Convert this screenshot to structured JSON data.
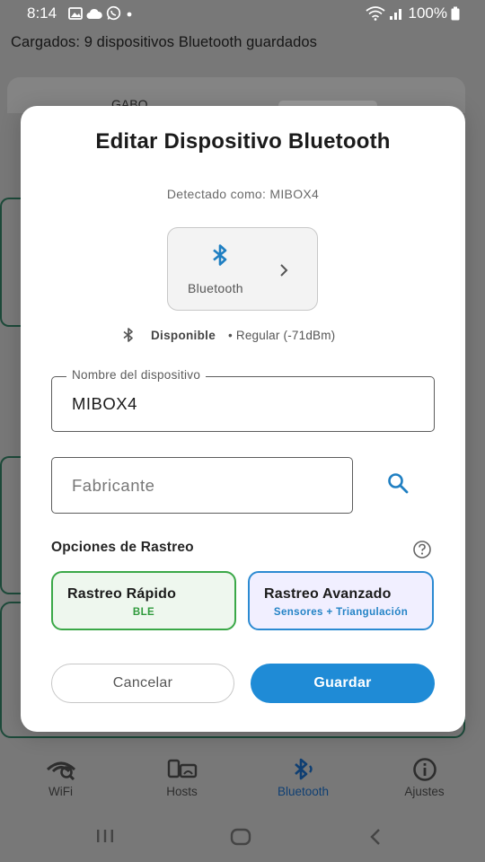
{
  "status_bar": {
    "time": "8:14",
    "battery_text": "100%"
  },
  "background": {
    "header_text": "Cargados: 9 dispositivos Bluetooth guardados",
    "card_name": "GABO"
  },
  "dialog": {
    "title": "Editar Dispositivo Bluetooth",
    "detected": "Detectado como: MIBOX4",
    "device_type": {
      "icon": "bluetooth-icon",
      "label": "Bluetooth"
    },
    "status": {
      "availability": "Disponible",
      "signal": "• Regular (-71dBm)"
    },
    "name_field": {
      "legend": "Nombre del dispositivo",
      "value": "MIBOX4"
    },
    "maker_field": {
      "placeholder": "Fabricante"
    },
    "options": {
      "title": "Opciones de Rastreo",
      "fast": {
        "title": "Rastreo Rápido",
        "subtitle": "BLE"
      },
      "advanced": {
        "title": "Rastreo Avanzado",
        "subtitle": "Sensores + Triangulación"
      }
    },
    "buttons": {
      "cancel": "Cancelar",
      "save": "Guardar"
    }
  },
  "bottom_nav": {
    "items": [
      {
        "label": "WiFi",
        "icon": "wifi-eye-icon"
      },
      {
        "label": "Hosts",
        "icon": "hosts-icon"
      },
      {
        "label": "Bluetooth",
        "icon": "bluetooth-icon",
        "active": true
      },
      {
        "label": "Ajustes",
        "icon": "info-icon"
      }
    ]
  },
  "colors": {
    "accent": "#1f8bd6",
    "fast_green": "#3aa847",
    "advanced_blue": "#2b8ad2",
    "scrim": "#787878"
  }
}
